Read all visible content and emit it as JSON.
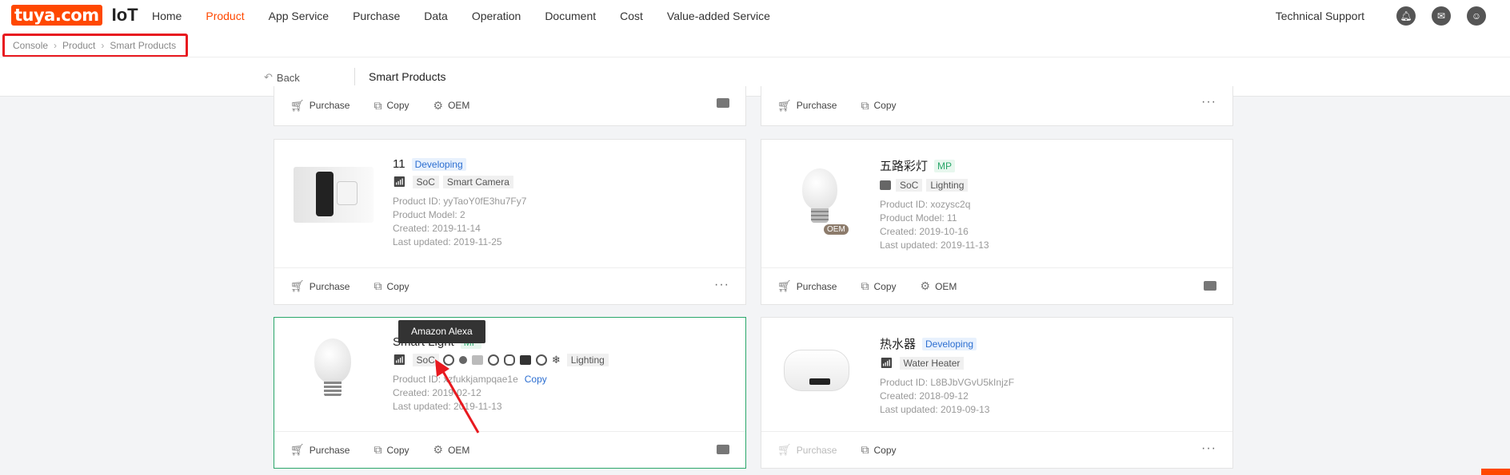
{
  "brand": {
    "logo_text": "tuya.com",
    "product": "IoT",
    "accent": "#ff4800"
  },
  "nav": {
    "items": [
      "Home",
      "Product",
      "App Service",
      "Purchase",
      "Data",
      "Operation",
      "Document",
      "Cost",
      "Value-added Service"
    ],
    "active": "Product",
    "tech_support": "Technical Support"
  },
  "breadcrumb": {
    "items": [
      "Console",
      "Product",
      "Smart Products"
    ]
  },
  "subbar": {
    "back": "Back",
    "title": "Smart Products"
  },
  "actions": {
    "purchase": "Purchase",
    "copy": "Copy",
    "oem": "OEM",
    "more": "···"
  },
  "cards": [
    {
      "name": "11",
      "status": "Developing",
      "tags": [
        "SoC",
        "Smart Camera"
      ],
      "product_id": "Product ID: yyTaoY0fE3hu7Fy7",
      "model": "Product Model: 2",
      "created": "Created: 2019-11-14",
      "updated": "Last updated: 2019-11-25"
    },
    {
      "name": "五路彩灯",
      "status": "MP",
      "tags": [
        "SoC",
        "Lighting"
      ],
      "product_id": "Product ID: xozysc2q",
      "model": "Product Model: 11",
      "created": "Created: 2019-10-16",
      "updated": "Last updated: 2019-11-13",
      "chip": "OEM"
    },
    {
      "name": "Smart Light",
      "status": "MP",
      "tags": [
        "SoC",
        "Lighting"
      ],
      "product_id": "Product ID: xzfukkjampqae1e",
      "copy": "Copy",
      "created": "Created: 2019-02-12",
      "updated": "Last updated: 2019-11-13",
      "tooltip": "Amazon Alexa"
    },
    {
      "name": "热水器",
      "status": "Developing",
      "tags": [
        "Water Heater"
      ],
      "product_id": "Product ID: L8BJbVGvU5kInjzF",
      "created": "Created: 2018-09-12",
      "updated": "Last updated: 2019-09-13"
    }
  ]
}
